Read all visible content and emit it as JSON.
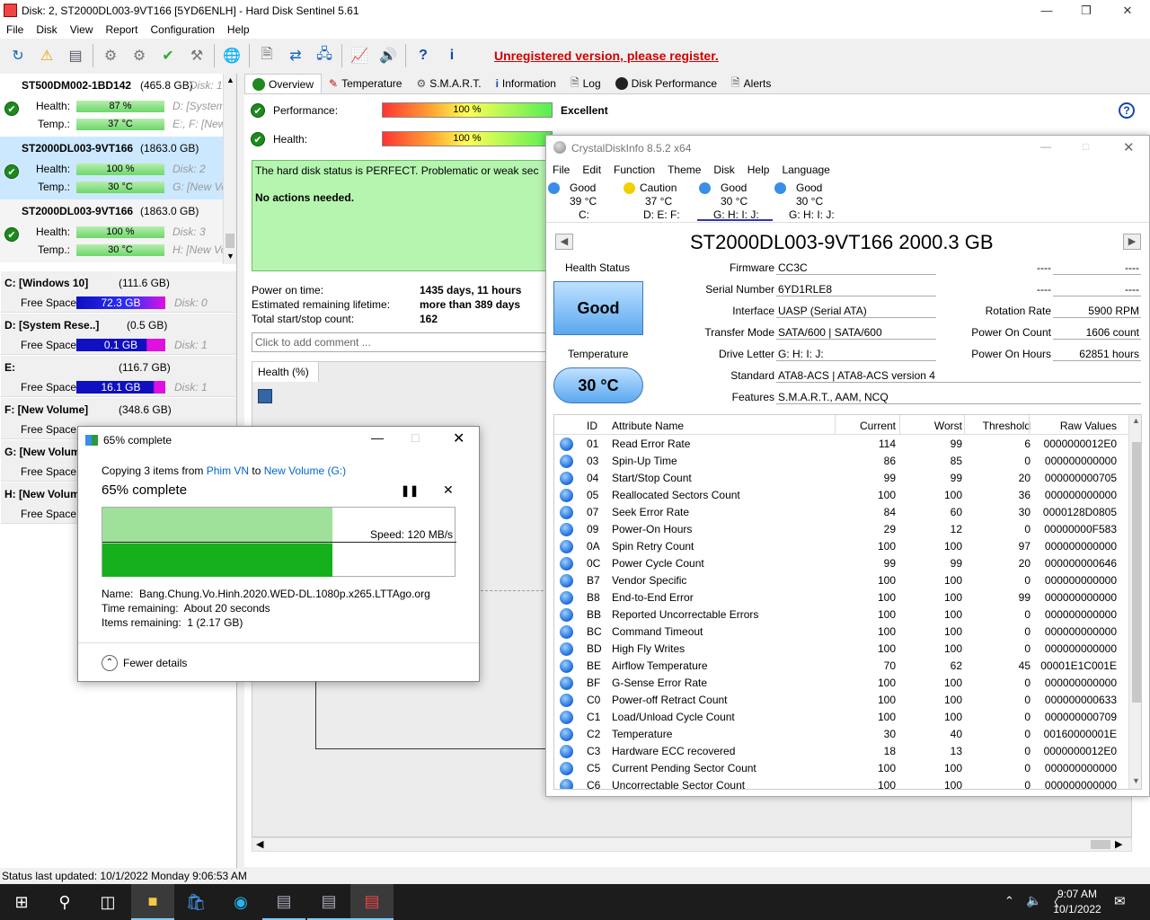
{
  "window": {
    "title": "Disk: 2, ST2000DL003-9VT166 [5YD6ENLH] - Hard Disk Sentinel 5.61"
  },
  "menu": [
    "File",
    "Disk",
    "View",
    "Report",
    "Configuration",
    "Help"
  ],
  "unregistered": "Unregistered version, please register.",
  "disks": [
    {
      "name": "ST500DM002-1BD142",
      "size": "(465.8 GB)",
      "disk": "Disk: 1",
      "health": "87 %",
      "temp": "37 °C",
      "letters1": "D: [System",
      "letters2": "E:, F: [New"
    },
    {
      "name": "ST2000DL003-9VT166",
      "size": "(1863.0 GB)",
      "disk": "Disk: 2",
      "health": "100 %",
      "temp": "30 °C",
      "letters1": "",
      "letters2": "G: [New Vo"
    },
    {
      "name": "ST2000DL003-9VT166",
      "size": "(1863.0 GB)",
      "disk": "Disk: 3",
      "health": "100 %",
      "temp": "30 °C",
      "letters1": "",
      "letters2": "H: [New Vo"
    }
  ],
  "labels": {
    "health": "Health:",
    "temp": "Temp.:",
    "freespace": "Free Space"
  },
  "volumes": [
    {
      "name": "C: [Windows 10]",
      "size": "(111.6 GB)",
      "free": "72.3 GB",
      "disk": "Disk: 0",
      "fill": 0.65
    },
    {
      "name": "D: [System Rese..]",
      "size": "(0.5 GB)",
      "free": "0.1 GB",
      "disk": "Disk: 1",
      "fill": 0.8
    },
    {
      "name": "E:",
      "size": "(116.7 GB)",
      "free": "16.1 GB",
      "disk": "Disk: 1",
      "fill": 0.86
    },
    {
      "name": "F: [New Volume]",
      "size": "(348.6 GB)",
      "free": "",
      "disk": ""
    },
    {
      "name": "G: [New Volum",
      "size": "",
      "free": "",
      "disk": ""
    },
    {
      "name": "H: [New Volum",
      "size": "",
      "free": "",
      "disk": ""
    }
  ],
  "tabs": [
    "Overview",
    "Temperature",
    "S.M.A.R.T.",
    "Information",
    "Log",
    "Disk Performance",
    "Alerts"
  ],
  "overview": {
    "performance_label": "Performance:",
    "performance": "100 %",
    "performance_rating": "Excellent",
    "health_label": "Health:",
    "health": "100 %",
    "status_text": "The hard disk status is PERFECT. Problematic or weak sec",
    "actions": "No actions needed.",
    "power_on_label": "Power on time:",
    "power_on": "1435 days, 11 hours",
    "lifetime_label": "Estimated remaining lifetime:",
    "lifetime": "more than 389 days",
    "startstop_label": "Total start/stop count:",
    "startstop": "162",
    "comment_placeholder": "Click to add comment ...",
    "health_tab": "Health (%)"
  },
  "status_bar": "Status last updated: 10/1/2022 Monday 9:06:53 AM",
  "cdi": {
    "title": "CrystalDiskInfo 8.5.2 x64",
    "menu": [
      "File",
      "Edit",
      "Function",
      "Theme",
      "Disk",
      "Help",
      "Language"
    ],
    "drives": [
      {
        "status": "Good",
        "temp": "39 °C",
        "letters": "C:",
        "color": "#3a8de8"
      },
      {
        "status": "Caution",
        "temp": "37 °C",
        "letters": "D: E: F:",
        "color": "#f0d000"
      },
      {
        "status": "Good",
        "temp": "30 °C",
        "letters": "G: H: I: J:",
        "color": "#3a8de8"
      },
      {
        "status": "Good",
        "temp": "30 °C",
        "letters": "G: H: I: J:",
        "color": "#3a8de8"
      }
    ],
    "model": "ST2000DL003-9VT166 2000.3 GB",
    "health_status_label": "Health Status",
    "health_status": "Good",
    "temperature_label": "Temperature",
    "temperature": "30 °C",
    "firmware_label": "Firmware",
    "firmware": "CC3C",
    "serial_label": "Serial Number",
    "serial": "6YD1RLE8",
    "interface_label": "Interface",
    "interface": "UASP (Serial ATA)",
    "transfer_label": "Transfer Mode",
    "transfer": "SATA/600 | SATA/600",
    "driveletter_label": "Drive Letter",
    "driveletter": "G: H: I: J:",
    "standard_label": "Standard",
    "standard": "ATA8-ACS | ATA8-ACS version 4",
    "features_label": "Features",
    "features": "S.M.A.R.T., AAM, NCQ",
    "dash": "----",
    "rotation_label": "Rotation Rate",
    "rotation": "5900 RPM",
    "poweroncount_label": "Power On Count",
    "poweroncount": "1606 count",
    "poweronhours_label": "Power On Hours",
    "poweronhours": "62851 hours",
    "columns": [
      "ID",
      "Attribute Name",
      "Current",
      "Worst",
      "Threshold",
      "Raw Values"
    ],
    "attributes": [
      [
        "01",
        "Read Error Rate",
        "114",
        "99",
        "6",
        "0000000012E0"
      ],
      [
        "03",
        "Spin-Up Time",
        "86",
        "85",
        "0",
        "000000000000"
      ],
      [
        "04",
        "Start/Stop Count",
        "99",
        "99",
        "20",
        "000000000705"
      ],
      [
        "05",
        "Reallocated Sectors Count",
        "100",
        "100",
        "36",
        "000000000000"
      ],
      [
        "07",
        "Seek Error Rate",
        "84",
        "60",
        "30",
        "0000128D0805"
      ],
      [
        "09",
        "Power-On Hours",
        "29",
        "12",
        "0",
        "00000000F583"
      ],
      [
        "0A",
        "Spin Retry Count",
        "100",
        "100",
        "97",
        "000000000000"
      ],
      [
        "0C",
        "Power Cycle Count",
        "99",
        "99",
        "20",
        "000000000646"
      ],
      [
        "B7",
        "Vendor Specific",
        "100",
        "100",
        "0",
        "000000000000"
      ],
      [
        "B8",
        "End-to-End Error",
        "100",
        "100",
        "99",
        "000000000000"
      ],
      [
        "BB",
        "Reported Uncorrectable Errors",
        "100",
        "100",
        "0",
        "000000000000"
      ],
      [
        "BC",
        "Command Timeout",
        "100",
        "100",
        "0",
        "000000000000"
      ],
      [
        "BD",
        "High Fly Writes",
        "100",
        "100",
        "0",
        "000000000000"
      ],
      [
        "BE",
        "Airflow Temperature",
        "70",
        "62",
        "45",
        "00001E1C001E"
      ],
      [
        "BF",
        "G-Sense Error Rate",
        "100",
        "100",
        "0",
        "000000000000"
      ],
      [
        "C0",
        "Power-off Retract Count",
        "100",
        "100",
        "0",
        "000000000633"
      ],
      [
        "C1",
        "Load/Unload Cycle Count",
        "100",
        "100",
        "0",
        "000000000709"
      ],
      [
        "C2",
        "Temperature",
        "30",
        "40",
        "0",
        "00160000001E"
      ],
      [
        "C3",
        "Hardware ECC recovered",
        "18",
        "13",
        "0",
        "0000000012E0"
      ],
      [
        "C5",
        "Current Pending Sector Count",
        "100",
        "100",
        "0",
        "000000000000"
      ],
      [
        "C6",
        "Uncorrectable Sector Count",
        "100",
        "100",
        "0",
        "000000000000"
      ]
    ]
  },
  "copy": {
    "title": "65% complete",
    "copying_prefix": "Copying 3 items from ",
    "from": "Phim VN",
    "to_word": " to ",
    "to": "New Volume (G:)",
    "percent_text": "65% complete",
    "progress": 0.65,
    "speed": "Speed: 120 MB/s",
    "name_label": "Name:",
    "name": "Bang.Chung.Vo.Hinh.2020.WED-DL.1080p.x265.LTTAgo.org",
    "time_label": "Time remaining:",
    "time": "About 20 seconds",
    "items_label": "Items remaining:",
    "items": "1 (2.17 GB)",
    "fewer": "Fewer details"
  },
  "clock": {
    "time": "9:07 AM",
    "date": "10/1/2022"
  }
}
